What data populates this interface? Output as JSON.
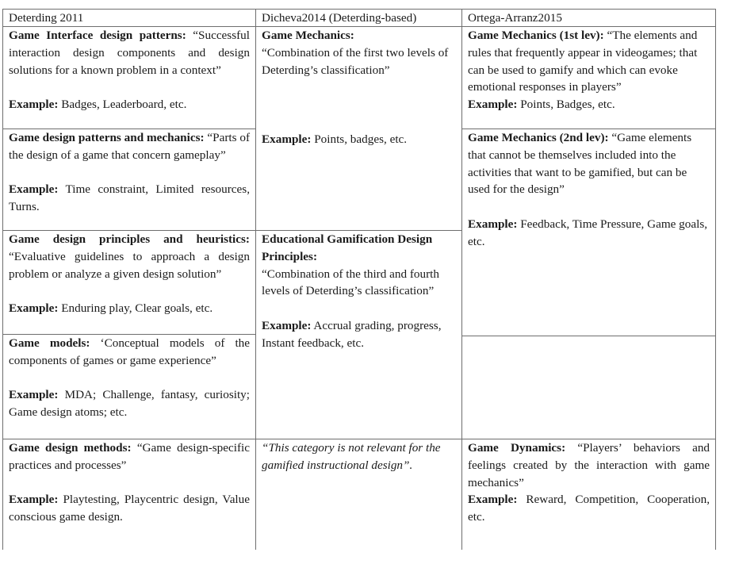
{
  "table": {
    "headers": [
      "Deterding 2011",
      "Dicheva2014 (Deterding-based)",
      "Ortega-Arranz2015"
    ],
    "deterding": [
      {
        "title": "Game Interface design patterns:",
        "definition": "“Successful interaction design components and design solutions for a known problem in a context”",
        "example_label": "Example:",
        "example": "Badges, Leaderboard, etc."
      },
      {
        "title": "Game design patterns and mechanics:",
        "definition": "“Parts of the design of a game that concern gameplay”",
        "example_label": "Example:",
        "example": "Time constraint, Limited resources, Turns."
      },
      {
        "title": "Game design principles and heuristics:",
        "definition": "“Evaluative guidelines to approach a design problem or analyze a given design solution”",
        "example_label": "Example:",
        "example": "Enduring play, Clear goals, etc."
      },
      {
        "title": "Game models:",
        "definition": "‘Conceptual models of the components of games or game experience”",
        "example_label": "Example:",
        "example": "MDA; Challenge, fantasy, curiosity; Game design atoms; etc."
      },
      {
        "title": "Game design methods:",
        "definition": "“Game design-specific practices and processes”",
        "example_label": "Example:",
        "example": "Playtesting, Playcentric design, Value conscious game design."
      }
    ],
    "dicheva": [
      {
        "title": "Game Mechanics:",
        "definition": "“Combination of the first two levels of Deterding’s classification”",
        "example_label": "Example:",
        "example": "Points, badges, etc."
      },
      {
        "title": "Educational Gamification Design Principles:",
        "definition": "“Combination of the third and fourth levels of Deterding’s classification”",
        "example_label": "Example:",
        "example": "Accrual grading, progress, Instant feedback, etc."
      },
      {
        "note": "“This category is not relevant for the gamified instructional design”."
      }
    ],
    "ortega": [
      {
        "title": "Game Mechanics (1st lev):",
        "definition": "“The elements and rules that frequently appear in videogames; that can be used to gamify and which can evoke emotional responses in players”",
        "example_label": "Example:",
        "example": "Points, Badges, etc."
      },
      {
        "title": "Game Mechanics (2nd lev):",
        "definition": "“Game elements that cannot be themselves included into the activities that want to be gamified, but can be used for the design”",
        "example_label": "Example:",
        "example": "Feedback, Time Pressure, Game goals, etc."
      },
      {
        "empty": ""
      },
      {
        "title": "Game Dynamics:",
        "definition": "“Players’ behaviors and feelings created by the interaction with game mechanics”",
        "example_label": "Example:",
        "example": "Reward, Competition, Cooperation, etc."
      }
    ]
  }
}
